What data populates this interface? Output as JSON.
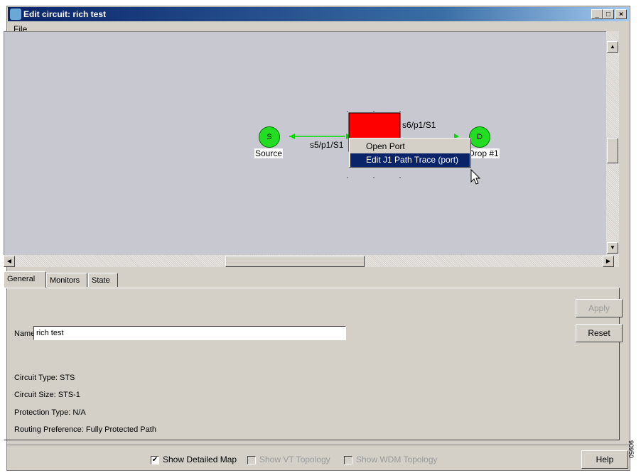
{
  "window": {
    "title": "Edit circuit: rich test",
    "minimize": "_",
    "maximize": "□",
    "close": "×"
  },
  "menu": {
    "file": "File"
  },
  "map": {
    "source_label": "Source",
    "source_letter": "S",
    "dest_label": "Drop #1",
    "dest_letter": "D",
    "link_left": "s5/p1/S1",
    "link_right": "s6/p1/S1"
  },
  "context_menu": {
    "items": [
      "Open Port",
      "Edit J1 Path Trace (port)"
    ]
  },
  "tabs": [
    "General",
    "Monitors",
    "State"
  ],
  "general": {
    "name_label": "Name:",
    "name_value": "rich test",
    "apply": "Apply",
    "reset": "Reset",
    "circuit_type": "Circuit Type:  STS",
    "circuit_size": "Circuit Size: STS-1",
    "protection_type": "Protection Type:  N/A",
    "routing_preference": "Routing Preference: Fully Protected Path"
  },
  "footer": {
    "show_detailed_map": "Show Detailed Map",
    "show_detailed_map_checked": true,
    "show_vt_topology": "Show VT Topology",
    "show_wdm_topology": "Show WDM Topology",
    "help": "Help"
  },
  "side_caption": "90950"
}
